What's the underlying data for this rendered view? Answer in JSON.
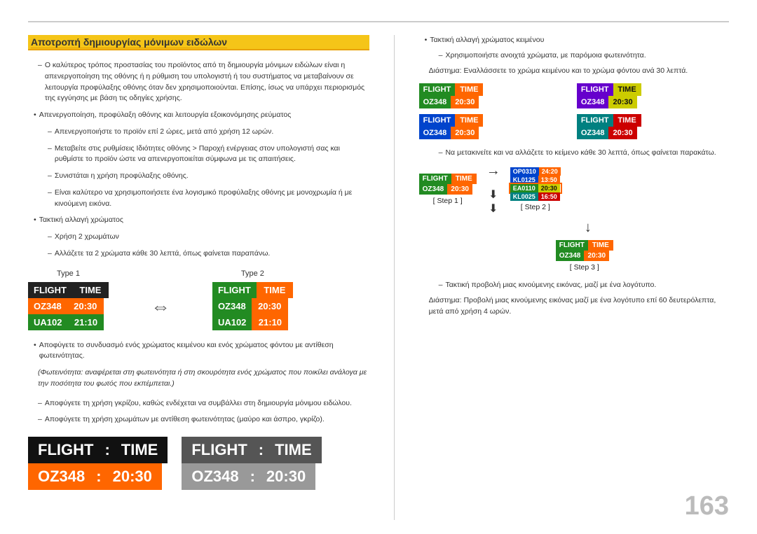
{
  "page": {
    "number": "163"
  },
  "heading": {
    "text": "Αποτροπή δημιουργίας μόνιμων ειδώλων"
  },
  "left": {
    "intro": "Ο καλύτερος τρόπος προστασίας του προϊόντος από τη δημιουργία μόνιμων ειδώλων είναι η απενεργοποίηση της οθόνης ή η ρύθμιση του υπολογιστή ή του συστήματος να μεταβαίνουν σε λειτουργία προφύλαξης οθόνης όταν δεν χρησιμοποιούνται. Επίσης, ίσως να υπάρχει περιορισμός της εγγύησης με βάση τις οδηγίες χρήσης.",
    "bullets": [
      {
        "text": "Απενεργοποίηση, προφύλαξη οθόνης και λειτουργία εξοικονόμησης ρεύματος"
      },
      {
        "text": "Τακτική αλλαγή χρώματος"
      }
    ],
    "sub_items": [
      "Απενεργοποιήστε το προϊόν επί 2 ώρες, μετά από χρήση 12 ωρών.",
      "Μεταβείτε στις ρυθμίσεις Ιδιότητες οθόνης > Παροχή ενέργειας στον υπολογιστή σας και ρυθμίστε το προϊόν ώστε να απενεργοποιείται σύμφωνα με τις απαιτήσεις.",
      "Συνιστάται η χρήση προφύλαξης οθόνης.",
      "Είναι καλύτερο να χρησιμοποιήσετε ένα λογισμικό προφύλαξης οθόνης με μονοχρωμία ή με κινούμενη εικόνα.",
      "Χρήση 2 χρωμάτων",
      "Αλλάζετε τα 2 χρώματα κάθε 30 λεπτά, όπως φαίνεται παραπάνω."
    ],
    "type1_label": "Type 1",
    "type2_label": "Type 2",
    "board1": {
      "header": [
        "FLIGHT",
        "TIME"
      ],
      "rows": [
        [
          "OZ348",
          "20:30"
        ],
        [
          "UA102",
          "21:10"
        ]
      ]
    },
    "board2": {
      "header": [
        "FLIGHT",
        "TIME"
      ],
      "rows": [
        [
          "OZ348",
          "20:30"
        ],
        [
          "UA102",
          "21:10"
        ]
      ]
    },
    "avoid_text": "Αποφύγετε το συνδυασμό ενός χρώματος κειμένου και ενός χρώματος φόντου με αντίθεση φωτεινότητας.",
    "brightness_note": "(Φωτεινότητα: αναφέρεται στη φωτεινότητα ή στη σκουρότητα ενός χρώματος που ποικίλει ανάλογα με την ποσότητα του φωτός που εκπέμπεται.)",
    "avoid_gray": "Αποφύγετε τη χρήση γκρίζου, καθώς ενδέχεται να συμβάλλει στη δημιουργία μόνιμου ειδώλου.",
    "avoid_contrast": "Αποφύγετε τη χρήση χρωμάτων με αντίθεση φωτεινότητας (μαύρο και άσπρο, γκρίζο).",
    "big_board1": {
      "header": [
        "FLIGHT",
        ":",
        "TIME"
      ],
      "row": [
        "OZ348",
        ":",
        "20:30"
      ]
    },
    "big_board2": {
      "header": [
        "FLIGHT",
        ":",
        "TIME"
      ],
      "row": [
        "OZ348",
        ":",
        "20:30"
      ]
    }
  },
  "right": {
    "color_change_heading": "Τακτική αλλαγή χρώματος κειμένου",
    "color_change_note": "Χρησιμοποιήστε ανοιχτά χρώματα, με παρόμοια φωτεινότητα.",
    "interval_note": "Διάστημα: Εναλλάσσετε το χρώμα κειμένου και το χρώμα φόντου ανά 30 λεπτά.",
    "boards_2x2": [
      {
        "header": [
          "FLIGHT",
          "TIME"
        ],
        "row": [
          "OZ348",
          "20:30"
        ],
        "theme": "green-orange"
      },
      {
        "header": [
          "FLIGHT",
          "TIME"
        ],
        "row": [
          "OZ348",
          "20:30"
        ],
        "theme": "purple-yellow"
      },
      {
        "header": [
          "FLIGHT",
          "TIME"
        ],
        "row": [
          "OZ348",
          "20:30"
        ],
        "theme": "blue-orange"
      },
      {
        "header": [
          "FLIGHT",
          "TIME"
        ],
        "row": [
          "OZ348",
          "20:30"
        ],
        "theme": "teal-red"
      }
    ],
    "step_note": "Να μετακινείτε και να αλλάζετε το κείμενο κάθε 30 λεπτά, όπως φαίνεται παρακάτω.",
    "step1_label": "[ Step 1 ]",
    "step2_label": "[ Step 2 ]",
    "step3_label": "[ Step 3 ]",
    "step1_board": {
      "header": [
        "FLIGHT",
        "TIME"
      ],
      "row": [
        "OZ348",
        "20:30"
      ]
    },
    "step2_rows": [
      [
        "OP0310",
        "24:20"
      ],
      [
        "KL0125",
        "13:50"
      ],
      [
        "EA0110",
        "20:30"
      ],
      [
        "KL0025",
        "16:50"
      ]
    ],
    "step3_board": {
      "header": [
        "FLIGHT",
        "TIME"
      ],
      "row": [
        "OZ348",
        "20:30"
      ]
    },
    "moving_image_heading": "Τακτική προβολή μιας κινούμενης εικόνας, μαζί με ένα λογότυπο.",
    "moving_image_note": "Διάστημα: Προβολή μιας κινούμενης εικόνας μαζί με ένα λογότυπο επί 60 δευτερόλεπτα, μετά από χρήση 4 ωρών."
  }
}
